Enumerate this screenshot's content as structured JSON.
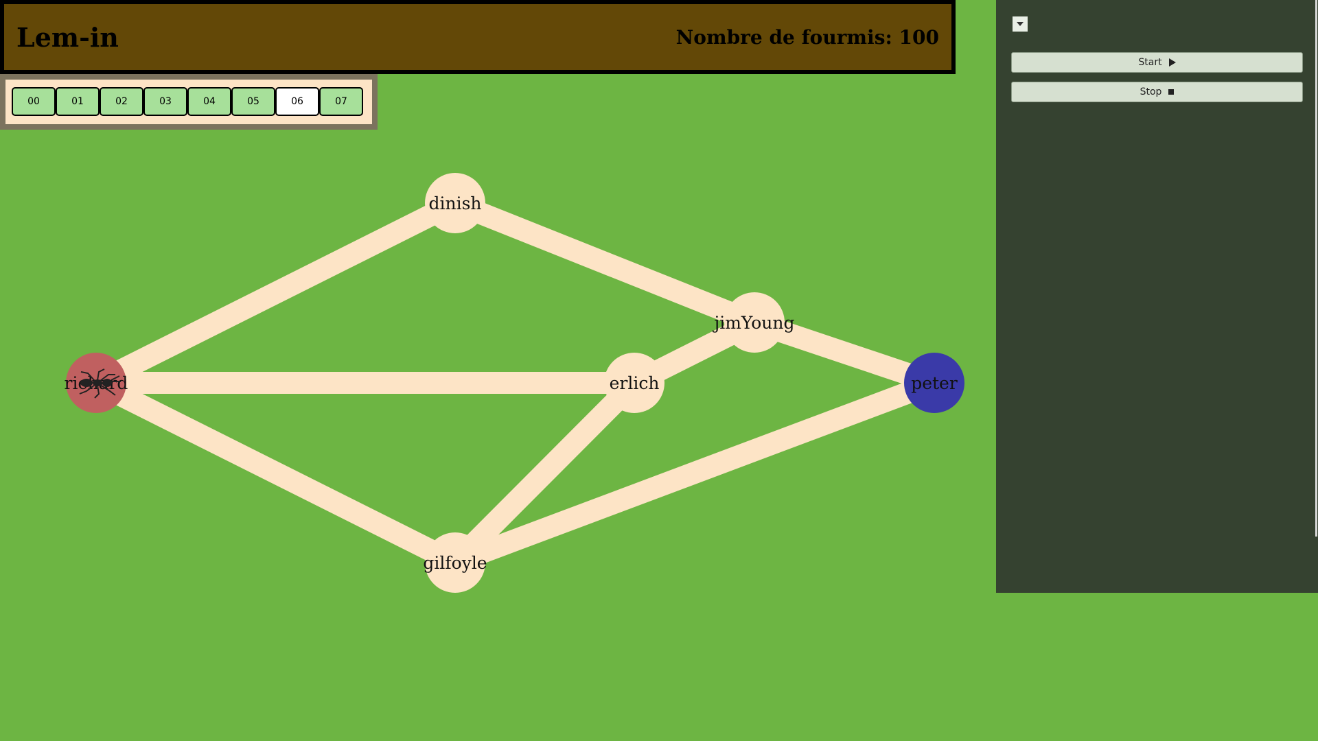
{
  "app": {
    "title": "Lem-in",
    "ant_count_label": "Nombre de fourmis: 100"
  },
  "maps": {
    "tabs": [
      "00",
      "01",
      "02",
      "03",
      "04",
      "05",
      "06",
      "07"
    ],
    "selected": "06"
  },
  "controls": {
    "start_label": "Start",
    "stop_label": "Stop"
  },
  "colors": {
    "background": "#6db543",
    "header": "#634807",
    "room": "#fde4c6",
    "link": "#fde4c6",
    "start_room": "#c06060",
    "end_room": "#3a3aa8",
    "tab_idle": "#a7e09a",
    "tab_active": "#ffffff",
    "panel": "#354230"
  },
  "graph": {
    "rooms": [
      {
        "name": "richard",
        "role": "start"
      },
      {
        "name": "dinish",
        "role": "normal"
      },
      {
        "name": "jimYoung",
        "role": "normal"
      },
      {
        "name": "erlich",
        "role": "normal"
      },
      {
        "name": "gilfoyle",
        "role": "normal"
      },
      {
        "name": "peter",
        "role": "end"
      }
    ],
    "links": [
      [
        "richard",
        "dinish"
      ],
      [
        "richard",
        "erlich"
      ],
      [
        "richard",
        "gilfoyle"
      ],
      [
        "dinish",
        "jimYoung"
      ],
      [
        "jimYoung",
        "erlich"
      ],
      [
        "jimYoung",
        "peter"
      ],
      [
        "erlich",
        "gilfoyle"
      ],
      [
        "gilfoyle",
        "peter"
      ]
    ],
    "ants": [
      {
        "room": "richard",
        "icon": "ant-icon"
      }
    ]
  }
}
